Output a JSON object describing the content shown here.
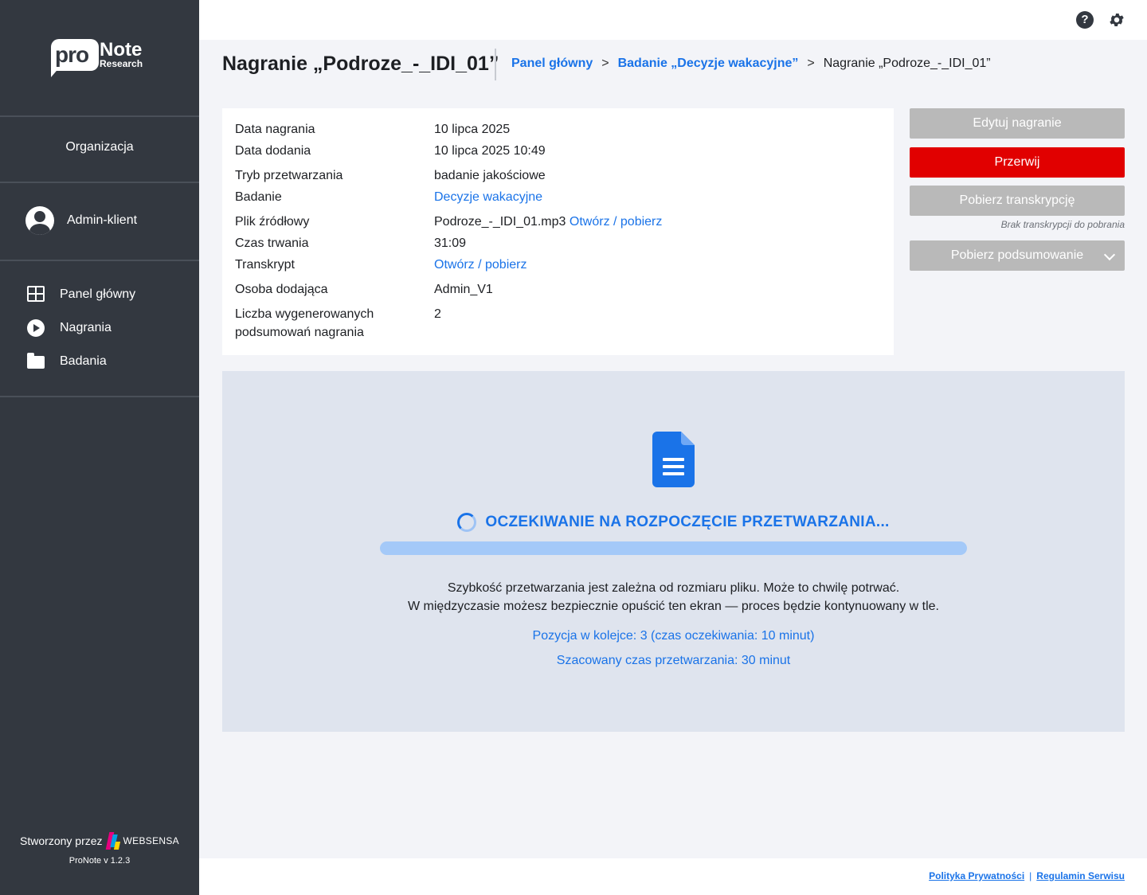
{
  "logo": {
    "pro": "pro",
    "note": "Note",
    "research": "Research"
  },
  "sidebar": {
    "organization": "Organizacja",
    "user": {
      "name": "Admin-klient",
      "icon": "account-circle-icon"
    },
    "nav": [
      {
        "label": "Panel główny",
        "icon": "dashboard-grid-icon"
      },
      {
        "label": "Nagrania",
        "icon": "play-circle-icon"
      },
      {
        "label": "Badania",
        "icon": "folder-icon"
      }
    ],
    "footer": {
      "created_by": "Stworzony przez",
      "brand": "WEBSENSA",
      "version": "ProNote v 1.2.3"
    }
  },
  "topbar": {
    "help_icon": "help-icon",
    "settings_icon": "gear-icon"
  },
  "header": {
    "title": "Nagranie „Podroze_-_IDI_01”",
    "breadcrumb": {
      "home": "Panel główny",
      "arrow": ">",
      "study": "Badanie „Decyzje wakacyjne”",
      "current": "Nagranie „Podroze_-_IDI_01”"
    }
  },
  "info": {
    "recording_date_label": "Data nagrania",
    "recording_date": "10 lipca 2025",
    "added_date_label": "Data dodania",
    "added_date": "10 lipca 2025 10:49",
    "mode_label": "Tryb przetwarzania",
    "mode": "badanie jakościowe",
    "study_label": "Badanie",
    "study": "Decyzje wakacyjne",
    "source_label": "Plik źródłowy",
    "source_file": "Podroze_-_IDI_01.mp3",
    "source_link": "Otwórz / pobierz",
    "duration_label": "Czas trwania",
    "duration": "31:09",
    "transcript_label": "Transkrypt",
    "transcript_link": "Otwórz / pobierz",
    "added_by_label": "Osoba dodająca",
    "added_by": "Admin_V1",
    "summaries_label_1": "Liczba wygenerowanych",
    "summaries_label_2": "podsumowań nagrania",
    "summaries_count": "2"
  },
  "actions": {
    "edit": "Edytuj nagranie",
    "abort": "Przerwij",
    "download_transcript": "Pobierz transkrypcję",
    "no_transcript_note": "Brak transkrypcji do pobrania",
    "download_summary": "Pobierz podsumowanie"
  },
  "processing": {
    "icon": "document-icon",
    "status": "OCZEKIWANIE NA ROZPOCZĘCIE PRZETWARZANIA...",
    "progress_fraction": 1.0,
    "desc_line1": "Szybkość przetwarzania jest zależna od rozmiaru pliku. Może to chwilę potrwać.",
    "desc_line2": "W międzyczasie możesz bezpiecznie opuścić ten ekran — proces będzie kontynuowany w tle.",
    "queue": "Pozycja w kolejce: 3 (czas oczekiwania: 10 minut)",
    "estimate": "Szacowany czas przetwarzania: 30 minut"
  },
  "footer_links": {
    "privacy": "Polityka Prywatności",
    "separator": "|",
    "terms": "Regulamin Serwisu"
  },
  "colors": {
    "accent": "#1a73e8",
    "danger": "#e10000",
    "sidebar": "#333840",
    "disabled": "#b9b9b9",
    "panel": "#dfe4ee"
  }
}
